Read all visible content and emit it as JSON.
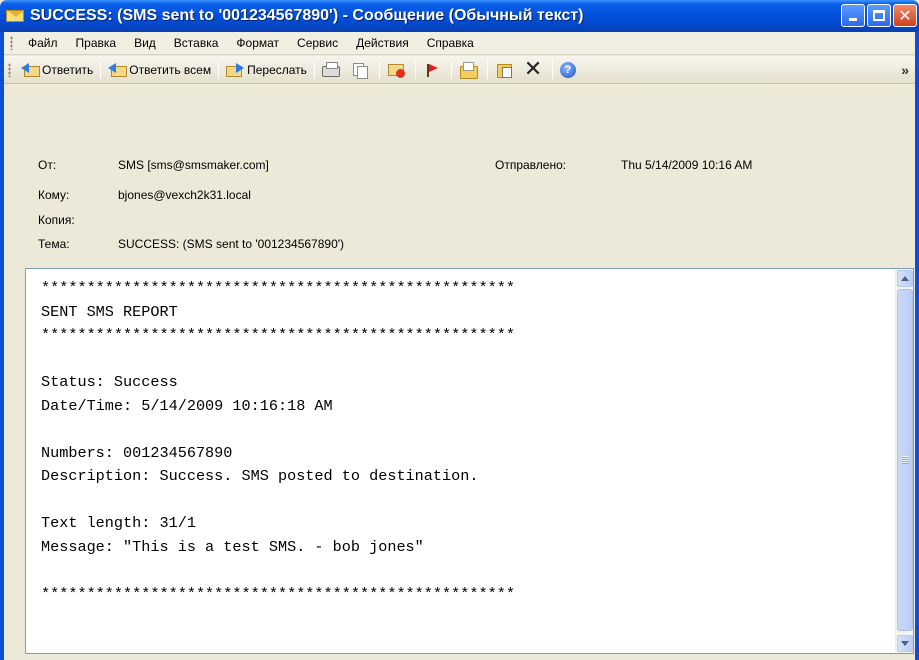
{
  "window": {
    "title": "SUCCESS:  (SMS sent to '001234567890') - Сообщение (Обычный текст)"
  },
  "menu": [
    {
      "label": "Файл"
    },
    {
      "label": "Правка"
    },
    {
      "label": "Вид"
    },
    {
      "label": "Вставка"
    },
    {
      "label": "Формат"
    },
    {
      "label": "Сервис"
    },
    {
      "label": "Действия"
    },
    {
      "label": "Справка"
    }
  ],
  "toolbar": {
    "reply_label": "Ответить",
    "reply_all_label": "Ответить всем",
    "forward_label": "Переслать"
  },
  "header": {
    "from_label": "От:",
    "from_value": "SMS [sms@smsmaker.com]",
    "sent_label": "Отправлено:",
    "sent_value": "Thu 5/14/2009 10:16 AM",
    "to_label": "Кому:",
    "to_value": "bjones@vexch2k31.local",
    "cc_label": "Копия:",
    "cc_value": "",
    "subject_label": "Тема:",
    "subject_value": "SUCCESS:  (SMS sent to '001234567890')"
  },
  "body": {
    "text": "****************************************************\nSENT SMS REPORT\n****************************************************\n\nStatus: Success\nDate/Time: 5/14/2009 10:16:18 AM\n\nNumbers: 001234567890\nDescription: Success. SMS posted to destination.\n\nText length: 31/1\nMessage: \"This is a test SMS. - bob jones\"\n\n****************************************************"
  },
  "colors": {
    "titlebar": "#0350d8",
    "chrome": "#ece9d8",
    "body_border": "#7f9db9"
  }
}
